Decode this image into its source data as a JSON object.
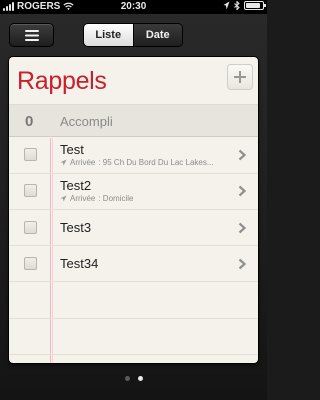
{
  "status_bar": {
    "carrier": "ROGERS",
    "time": "20:30",
    "signal_bars": 4,
    "battery_level": 0.85
  },
  "nav": {
    "menu_icon": "menu-icon",
    "tabs": [
      {
        "label": "Liste",
        "active": true
      },
      {
        "label": "Date",
        "active": false
      }
    ]
  },
  "list": {
    "title": "Rappels",
    "add_icon": "plus-icon",
    "completed": {
      "count": "0",
      "label": "Accompli"
    },
    "items": [
      {
        "title": "Test",
        "location_prefix": "Arrivée",
        "location": ": 95 Ch Du Bord Du Lac Lakes..."
      },
      {
        "title": "Test2",
        "location_prefix": "Arrivée",
        "location": ": Domicile"
      },
      {
        "title": "Test3"
      },
      {
        "title": "Test34"
      }
    ]
  },
  "pagination": {
    "pages": 2,
    "current": 2
  },
  "colors": {
    "title": "#c8202c",
    "paper": "#f4f2ea"
  }
}
